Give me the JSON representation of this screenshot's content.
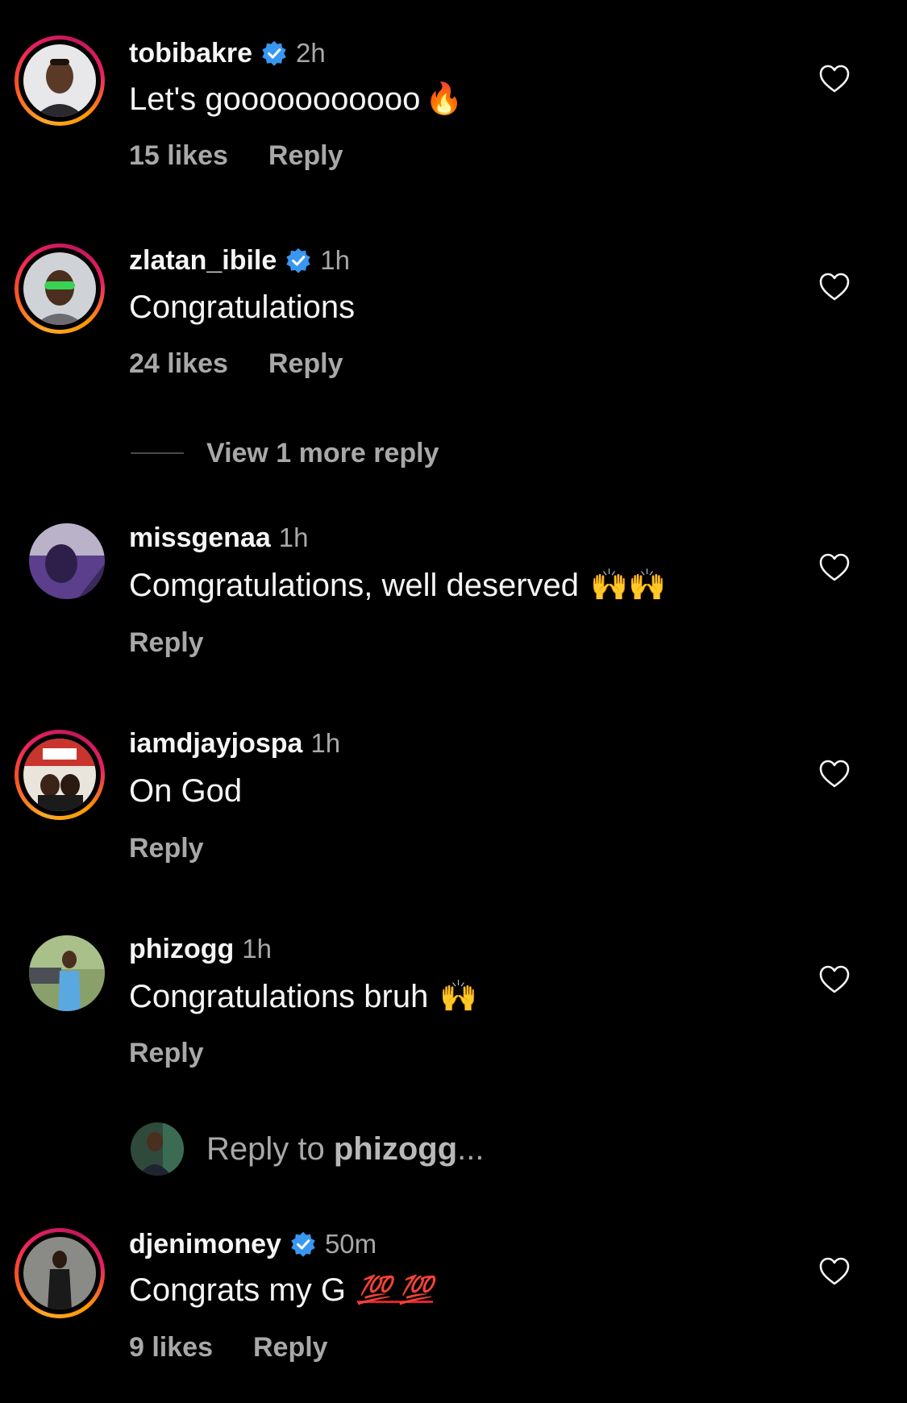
{
  "comments": [
    {
      "username": "tobibakre",
      "verified": true,
      "time": "2h",
      "text": "Let's gooooooooooo",
      "emoji": "🔥",
      "likes": "15 likes",
      "reply_label": "Reply",
      "story_ring": true
    },
    {
      "username": "zlatan_ibile",
      "verified": true,
      "time": "1h",
      "text": "Congratulations",
      "likes": "24 likes",
      "reply_label": "Reply",
      "story_ring": true
    },
    {
      "username": "missgenaa",
      "verified": false,
      "time": "1h",
      "text": "Comgratulations, well deserved",
      "emoji": "🙌🙌",
      "reply_label": "Reply",
      "story_ring": false
    },
    {
      "username": "iamdjayjospa",
      "verified": false,
      "time": "1h",
      "text": "On God",
      "reply_label": "Reply",
      "story_ring": true
    },
    {
      "username": "phizogg",
      "verified": false,
      "time": "1h",
      "text": "Congratulations bruh",
      "emoji": "🙌",
      "reply_label": "Reply",
      "story_ring": false
    },
    {
      "username": "djenimoney",
      "verified": true,
      "time": "50m",
      "text": "Congrats my G",
      "emoji": "💯 💯",
      "likes": "9 likes",
      "reply_label": "Reply",
      "story_ring": true
    }
  ],
  "view_more": "View 1 more reply",
  "reply_box": {
    "prefix": "Reply to",
    "username": "phizogg",
    "suffix": "..."
  },
  "icons": {
    "heart": "heart-outline-icon",
    "verified": "verified-badge-icon"
  },
  "colors": {
    "background": "#000000",
    "primary_text": "#f5f5f5",
    "secondary_text": "#a8a8a8",
    "verified_blue": "#3897f0"
  }
}
